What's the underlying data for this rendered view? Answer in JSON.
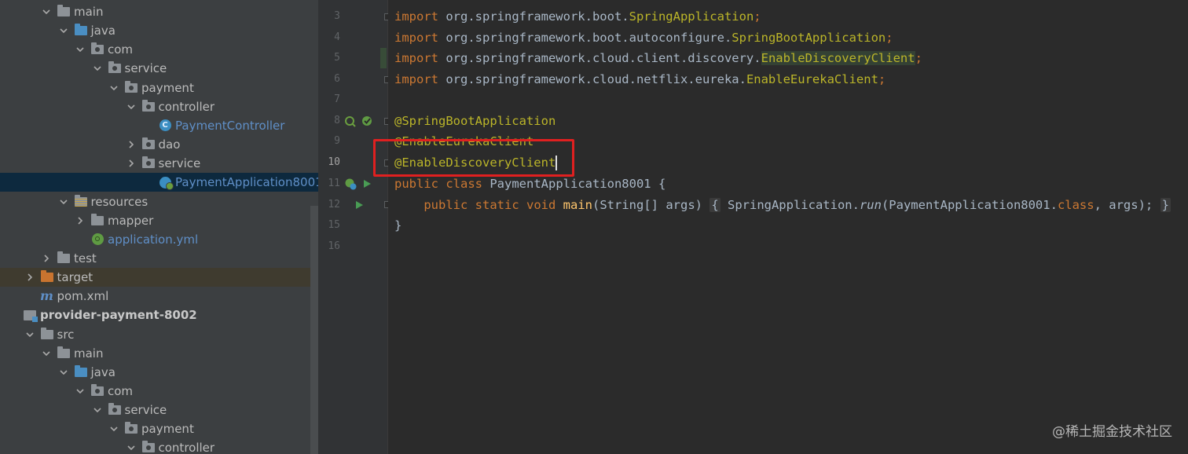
{
  "project_tree": {
    "rows": [
      {
        "label": "main",
        "indent": 2,
        "chevron": "down",
        "icon": "folder-icon"
      },
      {
        "label": "java",
        "indent": 3,
        "chevron": "down",
        "icon": "source-folder-icon"
      },
      {
        "label": "com",
        "indent": 4,
        "chevron": "down",
        "icon": "package-icon"
      },
      {
        "label": "service",
        "indent": 5,
        "chevron": "down",
        "icon": "package-icon"
      },
      {
        "label": "payment",
        "indent": 6,
        "chevron": "down",
        "icon": "package-icon"
      },
      {
        "label": "controller",
        "indent": 7,
        "chevron": "down",
        "icon": "package-icon"
      },
      {
        "label": "PaymentController",
        "indent": 8,
        "chevron": "none",
        "icon": "class-icon",
        "style": "blue"
      },
      {
        "label": "dao",
        "indent": 7,
        "chevron": "right",
        "icon": "package-icon"
      },
      {
        "label": "service",
        "indent": 7,
        "chevron": "right",
        "icon": "package-icon"
      },
      {
        "label": "PaymentApplication8001",
        "indent": 8,
        "chevron": "none",
        "icon": "spring-boot-class-icon",
        "style": "blue",
        "selected": true
      },
      {
        "label": "resources",
        "indent": 3,
        "chevron": "down",
        "icon": "resources-folder-icon"
      },
      {
        "label": "mapper",
        "indent": 4,
        "chevron": "right",
        "icon": "folder-icon"
      },
      {
        "label": "application.yml",
        "indent": 4,
        "chevron": "none",
        "icon": "spring-yml-icon",
        "style": "blue"
      },
      {
        "label": "test",
        "indent": 2,
        "chevron": "right",
        "icon": "folder-icon"
      },
      {
        "label": "target",
        "indent": 1,
        "chevron": "right",
        "icon": "excluded-folder-icon",
        "excluded": true
      },
      {
        "label": "pom.xml",
        "indent": 1,
        "chevron": "none",
        "icon": "maven-icon"
      },
      {
        "label": "provider-payment-8002",
        "indent": 0,
        "chevron": "none",
        "icon": "module-icon",
        "style": "bold"
      },
      {
        "label": "src",
        "indent": 1,
        "chevron": "down",
        "icon": "folder-icon"
      },
      {
        "label": "main",
        "indent": 2,
        "chevron": "down",
        "icon": "folder-icon"
      },
      {
        "label": "java",
        "indent": 3,
        "chevron": "down",
        "icon": "source-folder-icon"
      },
      {
        "label": "com",
        "indent": 4,
        "chevron": "down",
        "icon": "package-icon"
      },
      {
        "label": "service",
        "indent": 5,
        "chevron": "down",
        "icon": "package-icon"
      },
      {
        "label": "payment",
        "indent": 6,
        "chevron": "down",
        "icon": "package-icon"
      },
      {
        "label": "controller",
        "indent": 7,
        "chevron": "down",
        "icon": "package-icon"
      }
    ]
  },
  "editor": {
    "line_numbers": [
      "3",
      "4",
      "5",
      "6",
      "7",
      "8",
      "9",
      "10",
      "11",
      "12",
      "15",
      "16"
    ],
    "current_line": "10",
    "lines": {
      "l3": {
        "kw": "import",
        "pkg": " org.springframework.boot.",
        "cls": "SpringApplication",
        "end": ";"
      },
      "l4": {
        "kw": "import",
        "pkg": " org.springframework.boot.autoconfigure.",
        "cls": "SpringBootApplication",
        "end": ";"
      },
      "l5": {
        "kw": "import",
        "pkg": " org.springframework.cloud.client.discovery.",
        "cls": "EnableDiscoveryClient",
        "end": ";"
      },
      "l6": {
        "kw": "import",
        "pkg": " org.springframework.cloud.netflix.eureka.",
        "cls": "EnableEurekaClient",
        "end": ";"
      },
      "l8": {
        "ann": "@SpringBootApplication"
      },
      "l9": {
        "ann": "@EnableEurekaClient"
      },
      "l10": {
        "ann": "@EnableDiscoveryClient"
      },
      "l11": {
        "kw1": "public",
        "kw2": " class",
        "rest": " PaymentApplication8001 {"
      },
      "l12": {
        "indent": "    ",
        "kw1": "public",
        "kw2": " static",
        "kw3": " void",
        "mth": " main",
        "params": "(String[] args) ",
        "open": "{",
        "call_a": " SpringApplication.",
        "call_run": "run",
        "call_b": "(PaymentApplication8001.",
        "call_kw": "class",
        "call_c": ", args); ",
        "close": "}"
      },
      "l15": {
        "text": "}"
      }
    },
    "gutter_icons": [
      "bean-icon",
      "spring-boot-run-icon",
      "run-icon"
    ]
  },
  "watermark": "@稀土掘金技术社区",
  "colors": {
    "tree_bg": "#3c3f41",
    "editor_bg": "#2b2b2b",
    "selection": "#0d293e",
    "keyword": "#cc7832",
    "annotation": "#bbb529",
    "callout": "#e02020"
  }
}
